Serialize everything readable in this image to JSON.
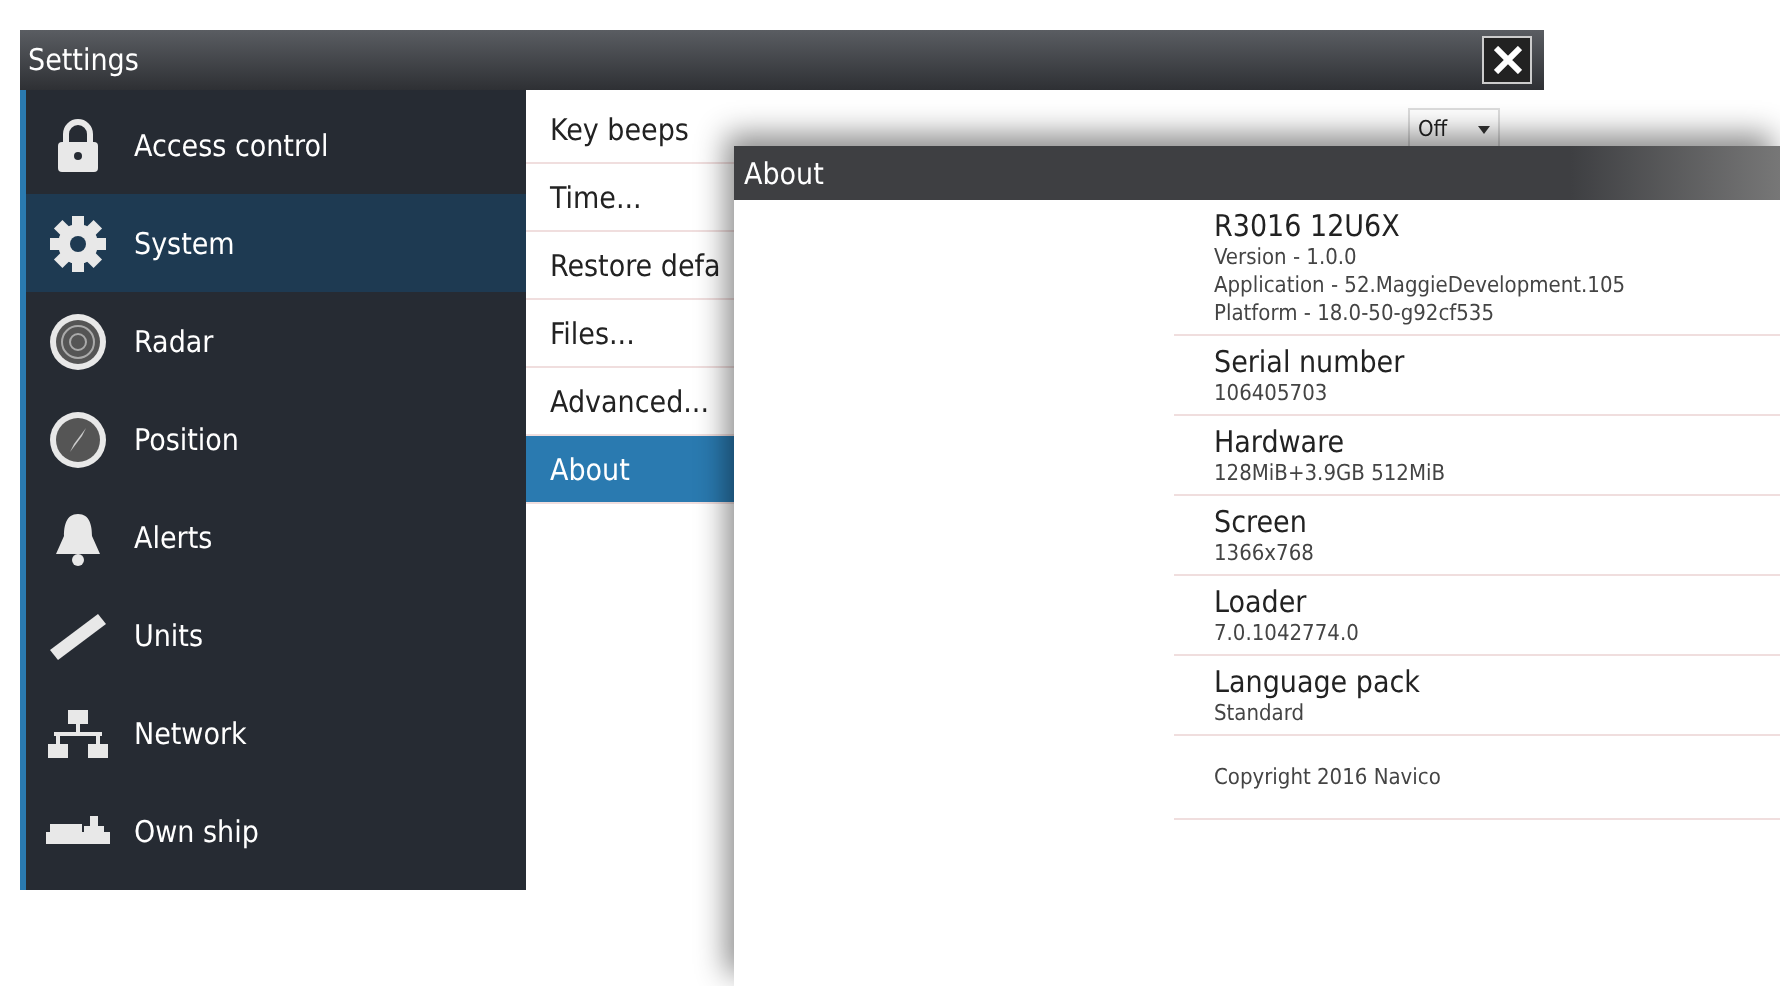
{
  "settings_window": {
    "title": "Settings",
    "sidebar": [
      {
        "label": "Access control",
        "selected": false
      },
      {
        "label": "System",
        "selected": true
      },
      {
        "label": "Radar",
        "selected": false
      },
      {
        "label": "Position",
        "selected": false
      },
      {
        "label": "Alerts",
        "selected": false
      },
      {
        "label": "Units",
        "selected": false
      },
      {
        "label": "Network",
        "selected": false
      },
      {
        "label": "Own ship",
        "selected": false
      }
    ],
    "menu": [
      {
        "label": "Key beeps",
        "selected": false,
        "dropdown": "Off"
      },
      {
        "label": "Time...",
        "selected": false
      },
      {
        "label": "Restore defa",
        "selected": false
      },
      {
        "label": "Files...",
        "selected": false
      },
      {
        "label": "Advanced...",
        "selected": false
      },
      {
        "label": "About",
        "selected": true
      }
    ]
  },
  "about_dialog": {
    "title": "About",
    "product": {
      "name": "R3016 12U6X",
      "lines": [
        "Version - 1.0.0",
        "Application - 52.MaggieDevelopment.105",
        "Platform - 18.0-50-g92cf535"
      ]
    },
    "sections": [
      {
        "heading": "Serial number",
        "value": "106405703"
      },
      {
        "heading": "Hardware",
        "value": "128MiB+3.9GB 512MiB"
      },
      {
        "heading": "Screen",
        "value": "1366x768"
      },
      {
        "heading": "Loader",
        "value": "7.0.1042774.0"
      },
      {
        "heading": "Language pack",
        "value": "Standard"
      }
    ],
    "copyright": "Copyright 2016 Navico"
  }
}
